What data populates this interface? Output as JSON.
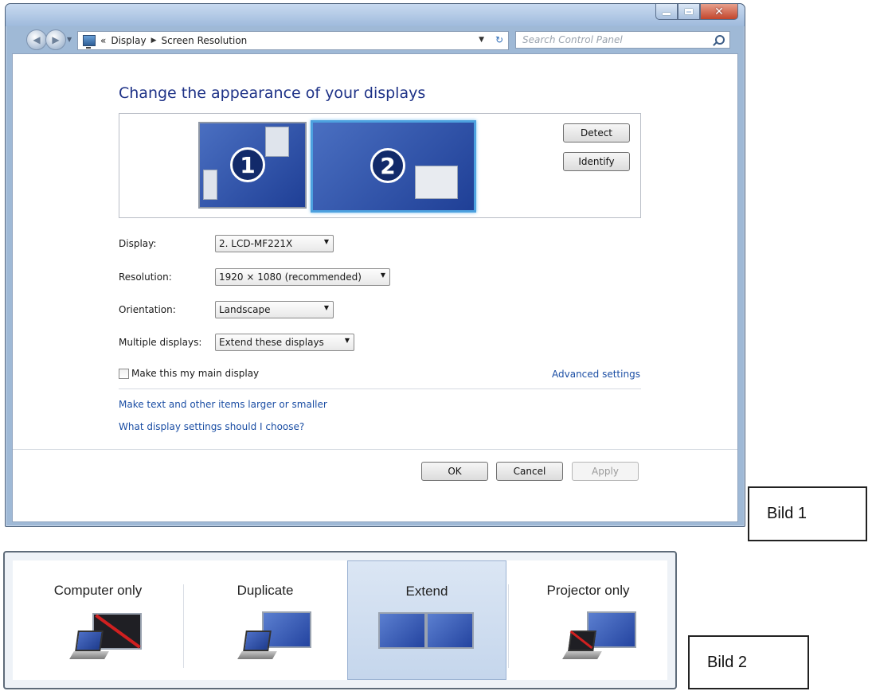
{
  "bild1": {
    "label": "Bild 1",
    "breadcrumb": {
      "prefix": "«",
      "items": [
        "Display",
        "Screen Resolution"
      ]
    },
    "search": {
      "placeholder": "Search Control Panel"
    },
    "heading": "Change the appearance of your displays",
    "monitors": [
      "1",
      "2"
    ],
    "buttons": {
      "detect": "Detect",
      "identify": "Identify",
      "ok": "OK",
      "cancel": "Cancel",
      "apply": "Apply"
    },
    "fields": {
      "display": {
        "label": "Display:",
        "value": "2. LCD-MF221X"
      },
      "resolution": {
        "label": "Resolution:",
        "value": "1920 × 1080 (recommended)"
      },
      "orientation": {
        "label": "Orientation:",
        "value": "Landscape"
      },
      "multiple": {
        "label": "Multiple displays:",
        "value": "Extend these displays"
      }
    },
    "main_display_checkbox": {
      "label": "Make this my main display",
      "checked": false
    },
    "links": {
      "advanced": "Advanced settings",
      "text_size": "Make text and other items larger or smaller",
      "help": "What display settings should I choose?"
    }
  },
  "bild2": {
    "label": "Bild 2",
    "options": [
      {
        "label": "Computer only",
        "selected": false,
        "icon": "computer-only-icon"
      },
      {
        "label": "Duplicate",
        "selected": false,
        "icon": "duplicate-icon"
      },
      {
        "label": "Extend",
        "selected": true,
        "icon": "extend-icon"
      },
      {
        "label": "Projector only",
        "selected": false,
        "icon": "projector-only-icon"
      }
    ]
  },
  "colors": {
    "heading": "#1e3287",
    "link": "#1b4ea4",
    "monitor": "#2f52ad",
    "selection": "#c5d6ec"
  }
}
